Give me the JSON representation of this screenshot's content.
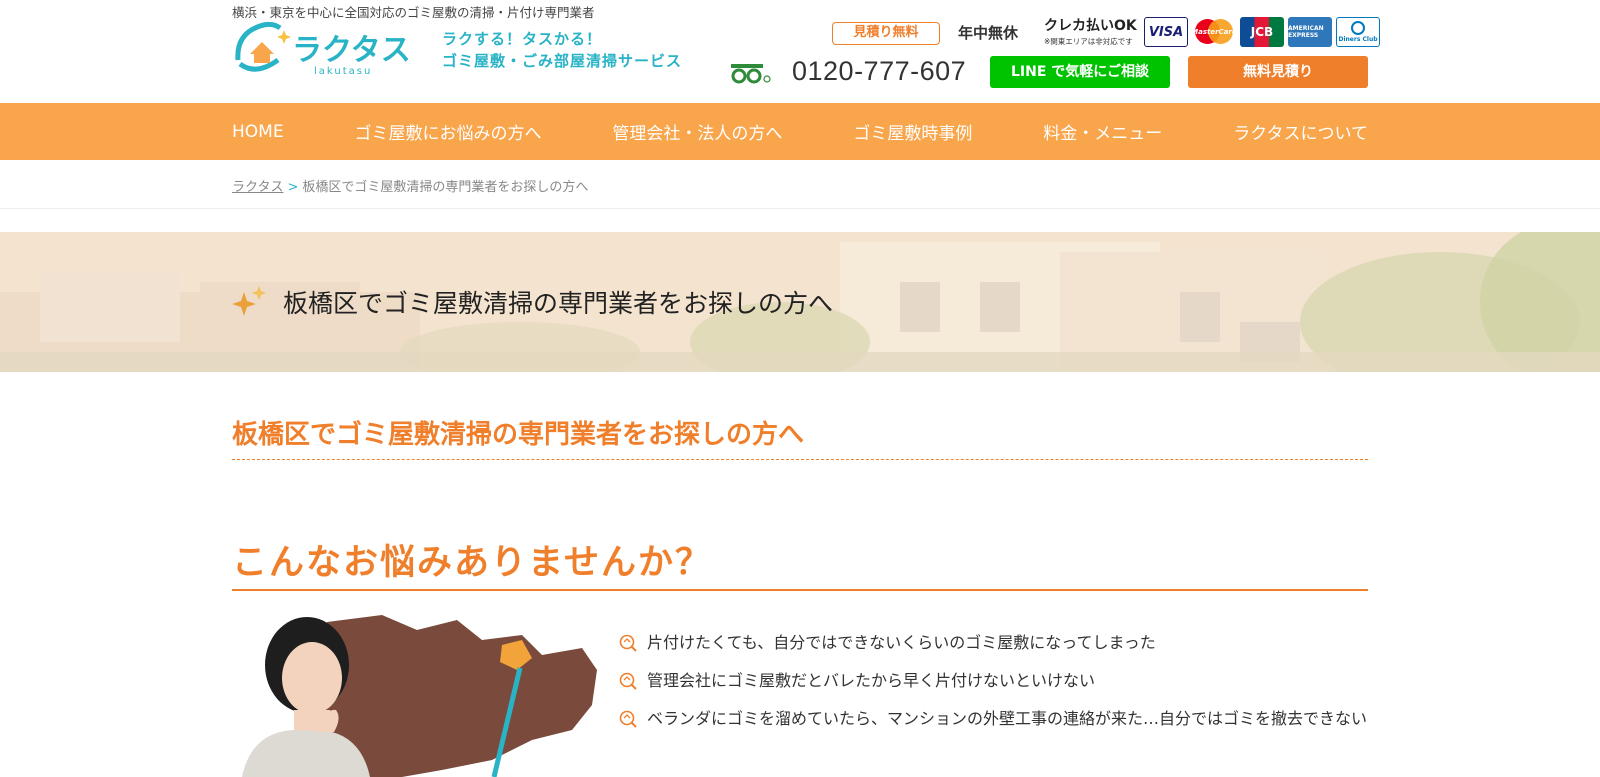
{
  "header": {
    "tagline": "横浜・東京を中心に全国対応のゴミ屋敷の清掃・片付け専門業者",
    "logo_text": "ラクタス",
    "logo_sub": "lakutasu",
    "catch_line1": "ラクする！タスかる！",
    "catch_line2": "ゴミ屋敷・ごみ部屋清掃サービス",
    "badge_free": "見積り無料",
    "open_all_year": "年中無休",
    "card_ok": "クレカ払いOK",
    "card_note": "※関東エリアは非対応です",
    "cards": [
      "VISA",
      "MasterCard",
      "JCB",
      "AMERICAN EXPRESS",
      "Diners Club"
    ],
    "phone": "0120-777-607",
    "line_button": "LINE で気軽にご相談",
    "estimate_button": "無料見積り"
  },
  "nav": {
    "items": [
      "HOME",
      "ゴミ屋敷にお悩みの方へ",
      "管理会社・法人の方へ",
      "ゴミ屋敷時事例",
      "料金・メニュー",
      "ラクタスについて"
    ]
  },
  "breadcrumb": {
    "home": "ラクタス",
    "separator": ">",
    "current": "板橋区でゴミ屋敷清掃の専門業者をお探しの方へ"
  },
  "hero": {
    "title": "板橋区でゴミ屋敷清掃の専門業者をお探しの方へ"
  },
  "main": {
    "heading": "板橋区でゴミ屋敷清掃の専門業者をお探しの方へ",
    "subheading": "こんなお悩みありませんか？",
    "worries": [
      "片付けたくても、自分ではできないくらいのゴミ屋敷になってしまった",
      "管理会社にゴミ屋敷だとバレたから早く片付けないといけない",
      "ベランダにゴミを溜めていたら、マンションの外壁工事の連絡が来た…自分ではゴミを撤去できない"
    ]
  },
  "colors": {
    "accent": "#f07f2c",
    "nav": "#f9a54c",
    "teal": "#29b3c6",
    "line": "#00c300"
  }
}
